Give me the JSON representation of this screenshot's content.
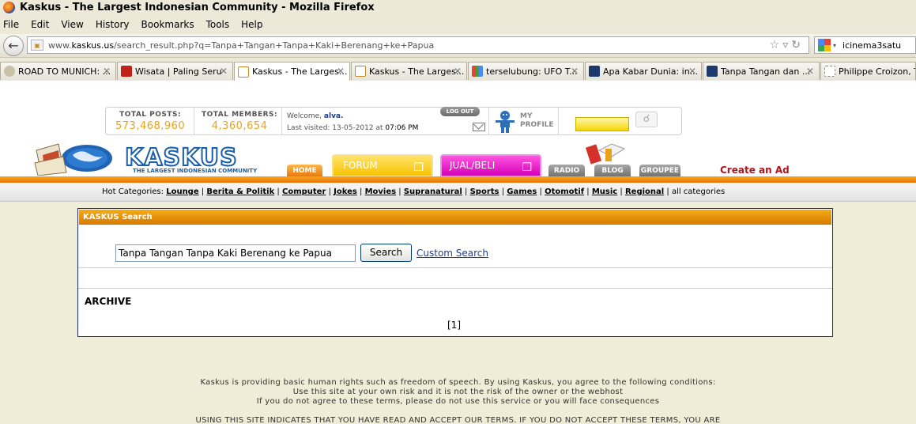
{
  "window": {
    "title": "Kaskus - The Largest Indonesian Community - Mozilla Firefox"
  },
  "menu": [
    "File",
    "Edit",
    "View",
    "History",
    "Bookmarks",
    "Tools",
    "Help"
  ],
  "navbar": {
    "url_prefix": "www.",
    "url_domain": "kaskus.us",
    "url_rest": "/search_result.php?q=Tanpa+Tangan+Tanpa+Kaki+Berenang+ke+Papua",
    "search_value": "icinema3satu"
  },
  "tabs": [
    {
      "label": "ROAD TO MUNICH: ...",
      "fav": "#c9c2a8",
      "active": false
    },
    {
      "label": "Wisata | Paling Seru",
      "fav": "#c0221a",
      "active": false
    },
    {
      "label": "Kaskus - The Larges...",
      "fav": "#c48b2b",
      "active": true
    },
    {
      "label": "Kaskus - The Larges...",
      "fav": "#c48b2b",
      "active": false
    },
    {
      "label": "terselubung: UFO T...",
      "fav": "#4a9a3a",
      "active": false
    },
    {
      "label": "Apa Kabar Dunia: in...",
      "fav": "#1c3a6e",
      "active": false
    },
    {
      "label": "Tanpa Tangan dan ...",
      "fav": "#1c3a6e",
      "active": false
    },
    {
      "label": "Philippe Croizon, Ta...",
      "fav": "#ffffff",
      "active": false
    }
  ],
  "header": {
    "total_posts_label": "TOTAL POSTS:",
    "total_posts": "573,468,960",
    "total_members_label": "TOTAL MEMBERS:",
    "total_members": "4,360,654",
    "welcome_prefix": "Welcome,",
    "username": "alva.",
    "last_visited_prefix": "Last visited: 13-05-2012 at",
    "last_visited_time": "07:06 PM",
    "logout_label": "LOG OUT",
    "my_profile_label_1": "MY",
    "my_profile_label_2": "PROFILE"
  },
  "brand": {
    "logo_text": "KASKUS",
    "tagline": "THE LARGEST INDONESIAN COMMUNITY"
  },
  "nav": {
    "home": "HOME",
    "forum": "FORUM",
    "jualbeli": "JUAL/BELI",
    "radio": "RADIO",
    "blog": "BLOG",
    "groupee": "GROUPEE",
    "create_ad": "Create an Ad"
  },
  "hot_categories": {
    "label": "Hot Categories:",
    "items": [
      "Lounge",
      "Berita & Politik",
      "Computer",
      "Jokes",
      "Movies",
      "Supranatural",
      "Sports",
      "Games",
      "Otomotif",
      "Music",
      "Regional"
    ],
    "all": "all categories"
  },
  "search_panel": {
    "title": "KASKUS Search",
    "query": "Tanpa Tangan Tanpa Kaki Berenang ke Papua",
    "button": "Search",
    "custom": "Custom Search",
    "archive": "ARCHIVE",
    "page": "[1]"
  },
  "footer": {
    "line1": "Kaskus is providing basic human rights such as freedom of speech. By using Kaskus, you agree to the following conditions:",
    "line2": "Use this site at your own risk and it is not the risk of the owner or the webhost",
    "line3": "If you do not agree to these terms, please do not use this service or you will face consequences",
    "line4": "USING THIS SITE INDICATES THAT YOU HAVE READ AND ACCEPT OUR TERMS. IF YOU DO NOT ACCEPT THESE TERMS, YOU ARE"
  }
}
